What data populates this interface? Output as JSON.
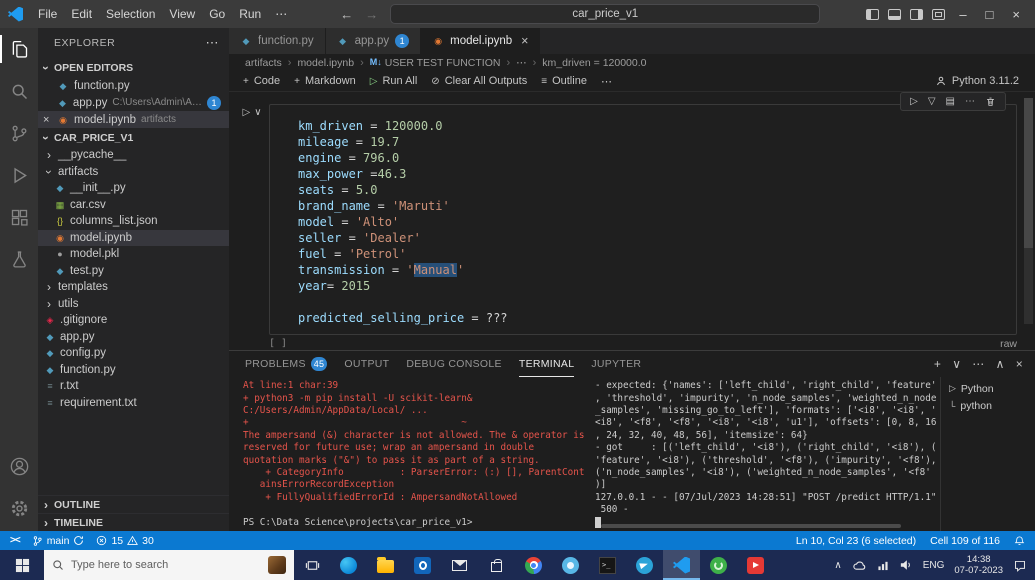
{
  "icons": {
    "more_h": "⋯",
    "back": "←",
    "forward": "→",
    "minimize": "–",
    "maximize": "□",
    "close": "×",
    "chevron_right": "›",
    "chevron_down": "∨",
    "chevron_up": "∧",
    "run": "▷",
    "plus": "+",
    "clear": "⊘",
    "outline_glyph": "≡",
    "remote": "><"
  },
  "file_icons": {
    "python": {
      "glyph": "◆",
      "color": "#519aba"
    },
    "csv": {
      "glyph": "▦",
      "color": "#8dc149"
    },
    "json": {
      "glyph": "{}",
      "color": "#cbcb41"
    },
    "notebook": {
      "glyph": "◉",
      "color": "#e37933"
    },
    "pickle": {
      "glyph": "●",
      "color": "#9e9e9e"
    },
    "text": {
      "glyph": "≡",
      "color": "#6d8086"
    },
    "git": {
      "glyph": "◈",
      "color": "#e8274b"
    }
  },
  "title_bar": {
    "menus": [
      "File",
      "Edit",
      "Selection",
      "View",
      "Go",
      "Run",
      "⋯"
    ],
    "search_title": "car_price_v1"
  },
  "activity_bar": {
    "top": [
      {
        "name": "explorer",
        "active": true
      },
      {
        "name": "search"
      },
      {
        "name": "source-control"
      },
      {
        "name": "run-debug"
      },
      {
        "name": "extensions"
      },
      {
        "name": "testing"
      }
    ],
    "bottom": [
      {
        "name": "account"
      },
      {
        "name": "settings"
      }
    ]
  },
  "explorer": {
    "title": "EXPLORER",
    "open_editors_label": "OPEN EDITORS",
    "open_editors": [
      {
        "label": "function.py",
        "kind": "python"
      },
      {
        "label": "app.py",
        "kind": "python",
        "detail": "C:\\Users\\Admin\\App...",
        "badge": "1"
      },
      {
        "label": "model.ipynb",
        "kind": "notebook",
        "detail": "artifacts",
        "active": true,
        "close": true
      }
    ],
    "project_label": "CAR_PRICE_V1",
    "tree": [
      {
        "label": "__pycache__",
        "kind": "folder",
        "chevron": "collapsed",
        "indent": 0
      },
      {
        "label": "artifacts",
        "kind": "folder",
        "chevron": "expanded",
        "indent": 0
      },
      {
        "label": "__init__.py",
        "kind": "python",
        "indent": 1
      },
      {
        "label": "car.csv",
        "kind": "csv",
        "indent": 1
      },
      {
        "label": "columns_list.json",
        "kind": "json",
        "indent": 1
      },
      {
        "label": "model.ipynb",
        "kind": "notebook",
        "indent": 1,
        "selected": true
      },
      {
        "label": "model.pkl",
        "kind": "pickle",
        "indent": 1
      },
      {
        "label": "test.py",
        "kind": "python",
        "indent": 1
      },
      {
        "label": "templates",
        "kind": "folder",
        "chevron": "collapsed",
        "indent": 0
      },
      {
        "label": "utils",
        "kind": "folder",
        "chevron": "collapsed",
        "indent": 0
      },
      {
        "label": ".gitignore",
        "kind": "git",
        "indent": 0
      },
      {
        "label": "app.py",
        "kind": "python",
        "indent": 0
      },
      {
        "label": "config.py",
        "kind": "python",
        "indent": 0
      },
      {
        "label": "function.py",
        "kind": "python",
        "indent": 0
      },
      {
        "label": "r.txt",
        "kind": "text",
        "indent": 0
      },
      {
        "label": "requirement.txt",
        "kind": "text",
        "indent": 0
      }
    ],
    "bottom_sections": [
      "OUTLINE",
      "TIMELINE"
    ]
  },
  "tabs": [
    {
      "label": "function.py",
      "kind": "python"
    },
    {
      "label": "app.py",
      "kind": "python",
      "badge": "1"
    },
    {
      "label": "model.ipynb",
      "kind": "notebook",
      "active": true,
      "close": true
    }
  ],
  "breadcrumbs": [
    {
      "label": "artifacts"
    },
    {
      "label": "model.ipynb"
    },
    {
      "label": "USER TEST FUNCTION",
      "icon": "M↓"
    },
    {
      "label": "⋯"
    },
    {
      "label": "km_driven = 120000.0"
    }
  ],
  "notebook_toolbar": {
    "code": "Code",
    "markdown": "Markdown",
    "run_all": "Run All",
    "clear": "Clear All Outputs",
    "outline": "Outline",
    "more": "⋯",
    "kernel": "Python 3.11.2"
  },
  "cell": {
    "toolbar_icons": [
      {
        "name": "execute-cell-icon",
        "glyph": "▷"
      },
      {
        "name": "execute-below-icon",
        "glyph": "▽"
      },
      {
        "name": "split-cell-icon",
        "glyph": "▤"
      },
      {
        "name": "more-actions-icon",
        "glyph": "⋯"
      },
      {
        "name": "delete-cell-icon",
        "glyph": "svg:trash"
      }
    ],
    "lines": [
      "km_driven = 120000.0",
      "mileage = 19.7",
      "engine = 796.0",
      "max_power =46.3",
      "seats = 5.0",
      "brand_name = 'Maruti'",
      "model = 'Alto'",
      "seller = 'Dealer'",
      "fuel = 'Petrol'",
      "transmission = 'Manual'",
      "year= 2015",
      "",
      "predicted_selling_price = ???"
    ],
    "selection": {
      "line_index": 9,
      "text": "Manual"
    },
    "exec_indicator": "[ ]",
    "language": "raw"
  },
  "panel": {
    "tabs": [
      {
        "label": "PROBLEMS",
        "badge": "45"
      },
      {
        "label": "OUTPUT"
      },
      {
        "label": "DEBUG CONSOLE"
      },
      {
        "label": "TERMINAL",
        "active": true
      },
      {
        "label": "JUPYTER"
      }
    ],
    "actions": [
      {
        "name": "new-terminal-icon",
        "glyph": "+"
      },
      {
        "name": "terminal-profile-icon",
        "glyph": "∨"
      },
      {
        "name": "more-actions-icon",
        "glyph": "⋯"
      },
      {
        "name": "maximize-panel-icon",
        "glyph": "∧"
      },
      {
        "name": "close-panel-icon",
        "glyph": "×"
      }
    ],
    "terminal_left": {
      "error_lines": [
        "At line:1 char:39",
        "+ python3 -m pip install -U scikit-learn&",
        "C:/Users/Admin/AppData/Local/ ...",
        "+                                      ~",
        "The ampersand (&) character is not allowed. The & operator is",
        "reserved for future use; wrap an ampersand in double",
        "quotation marks (\"&\") to pass it as part of a string.",
        "    + CategoryInfo          : ParserError: (:) [], ParentCont",
        "   ainsErrorRecordException",
        "    + FullyQualifiedErrorId : AmpersandNotAllowed"
      ],
      "prompt": "PS C:\\Data Science\\projects\\car_price_v1> "
    },
    "terminal_right": {
      "lines": [
        "- expected: {'names': ['left_child', 'right_child', 'feature'",
        ", 'threshold', 'impurity', 'n_node_samples', 'weighted_n_node",
        "_samples', 'missing_go_to_left'], 'formats': ['<i8', '<i8', '",
        "<i8', '<f8', '<f8', '<i8', '<i8', 'u1'], 'offsets': [0, 8, 16",
        ", 24, 32, 40, 48, 56], 'itemsize': 64}",
        "- got     : [('left_child', '<i8'), ('right_child', '<i8'), (",
        "'feature', '<i8'), ('threshold', '<f8'), ('impurity', '<f8'),",
        "('n_node_samples', '<i8'), ('weighted_n_node_samples', '<f8'",
        ")]",
        "127.0.0.1 - - [07/Jul/2023 14:28:51] \"POST /predict HTTP/1.1\"",
        " 500 -"
      ]
    },
    "terminal_list": [
      {
        "label": "Python"
      },
      {
        "label": "python",
        "child": true
      }
    ]
  },
  "status_bar": {
    "branch": "main",
    "errors": "15",
    "warnings": "30",
    "line_col": "Ln 10, Col 23 (6 selected)",
    "cell_info": "Cell 109 of 116"
  },
  "taskbar": {
    "search_placeholder": "Type here to search",
    "apps": [
      {
        "name": "edge-browser-icon",
        "style": "edge"
      },
      {
        "name": "file-explorer-icon",
        "style": "folder"
      },
      {
        "name": "outlook-icon",
        "style": "outlook"
      },
      {
        "name": "mail-icon",
        "style": "mail"
      },
      {
        "name": "microsoft-store-icon",
        "style": "store"
      },
      {
        "name": "chrome-icon",
        "style": "chrome"
      },
      {
        "name": "photos-icon",
        "style": "photos"
      },
      {
        "name": "terminal-icon",
        "style": "cmd"
      },
      {
        "name": "telegram-icon",
        "style": "telegram"
      },
      {
        "name": "vscode-icon",
        "style": "vscode",
        "active": true
      },
      {
        "name": "anaconda-icon",
        "style": "anaconda"
      },
      {
        "name": "youtube-icon",
        "style": "red"
      }
    ],
    "tray": {
      "lang": "ENG",
      "time": "14:38",
      "date": "07-07-2023"
    }
  }
}
